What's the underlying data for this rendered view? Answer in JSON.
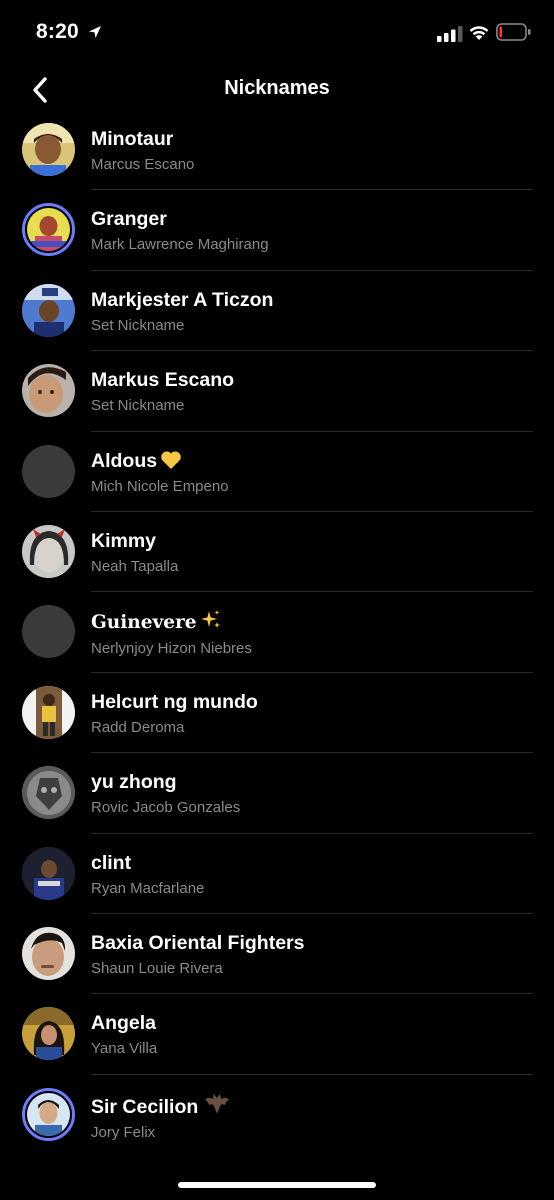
{
  "status_bar": {
    "time": "8:20",
    "signal_bars": 3,
    "battery_level": 0.1,
    "battery_color": "#ff3b30"
  },
  "nav": {
    "title": "Nicknames",
    "back_icon": "chevron-left-icon"
  },
  "contacts": [
    {
      "nickname": "Minotaur",
      "name": "Marcus Escano",
      "avatar": "photo"
    },
    {
      "nickname": "Granger",
      "name": "Mark Lawrence Maghirang",
      "avatar": "photo-story-ring"
    },
    {
      "nickname": "Markjester A Ticzon",
      "name": "Set Nickname",
      "avatar": "photo"
    },
    {
      "nickname": "Markus Escano",
      "name": "Set Nickname",
      "avatar": "photo"
    },
    {
      "nickname": "Aldous",
      "name": "Mich Nicole Empeno",
      "avatar": "placeholder",
      "emoji": "yellow-heart-icon"
    },
    {
      "nickname": "Kimmy",
      "name": "Neah Tapalla",
      "avatar": "photo"
    },
    {
      "nickname": "𝐆𝐮𝐢𝐧𝐞𝐯𝐞𝐫𝐞",
      "name": "Nerlynjoy Hizon Niebres",
      "avatar": "placeholder",
      "emoji": "sparkles-icon"
    },
    {
      "nickname": "Helcurt ng mundo",
      "name": "Radd Deroma",
      "avatar": "photo"
    },
    {
      "nickname": "yu zhong",
      "name": "Rovic Jacob Gonzales",
      "avatar": "photo"
    },
    {
      "nickname": "clint",
      "name": "Ryan Macfarlane",
      "avatar": "photo"
    },
    {
      "nickname": "Baxia Oriental Fighters",
      "name": "Shaun Louie Rivera",
      "avatar": "photo"
    },
    {
      "nickname": "Angela",
      "name": "Yana Villa",
      "avatar": "photo"
    },
    {
      "nickname": "Sir Cecilion",
      "name": "Jory Felix",
      "avatar": "photo-story-ring",
      "emoji": "bat-icon"
    }
  ],
  "colors": {
    "background": "#000000",
    "primary_text": "#ffffff",
    "secondary_text": "#8a8a8f",
    "divider": "#2a2a2c",
    "story_ring": "#6b7cff"
  }
}
